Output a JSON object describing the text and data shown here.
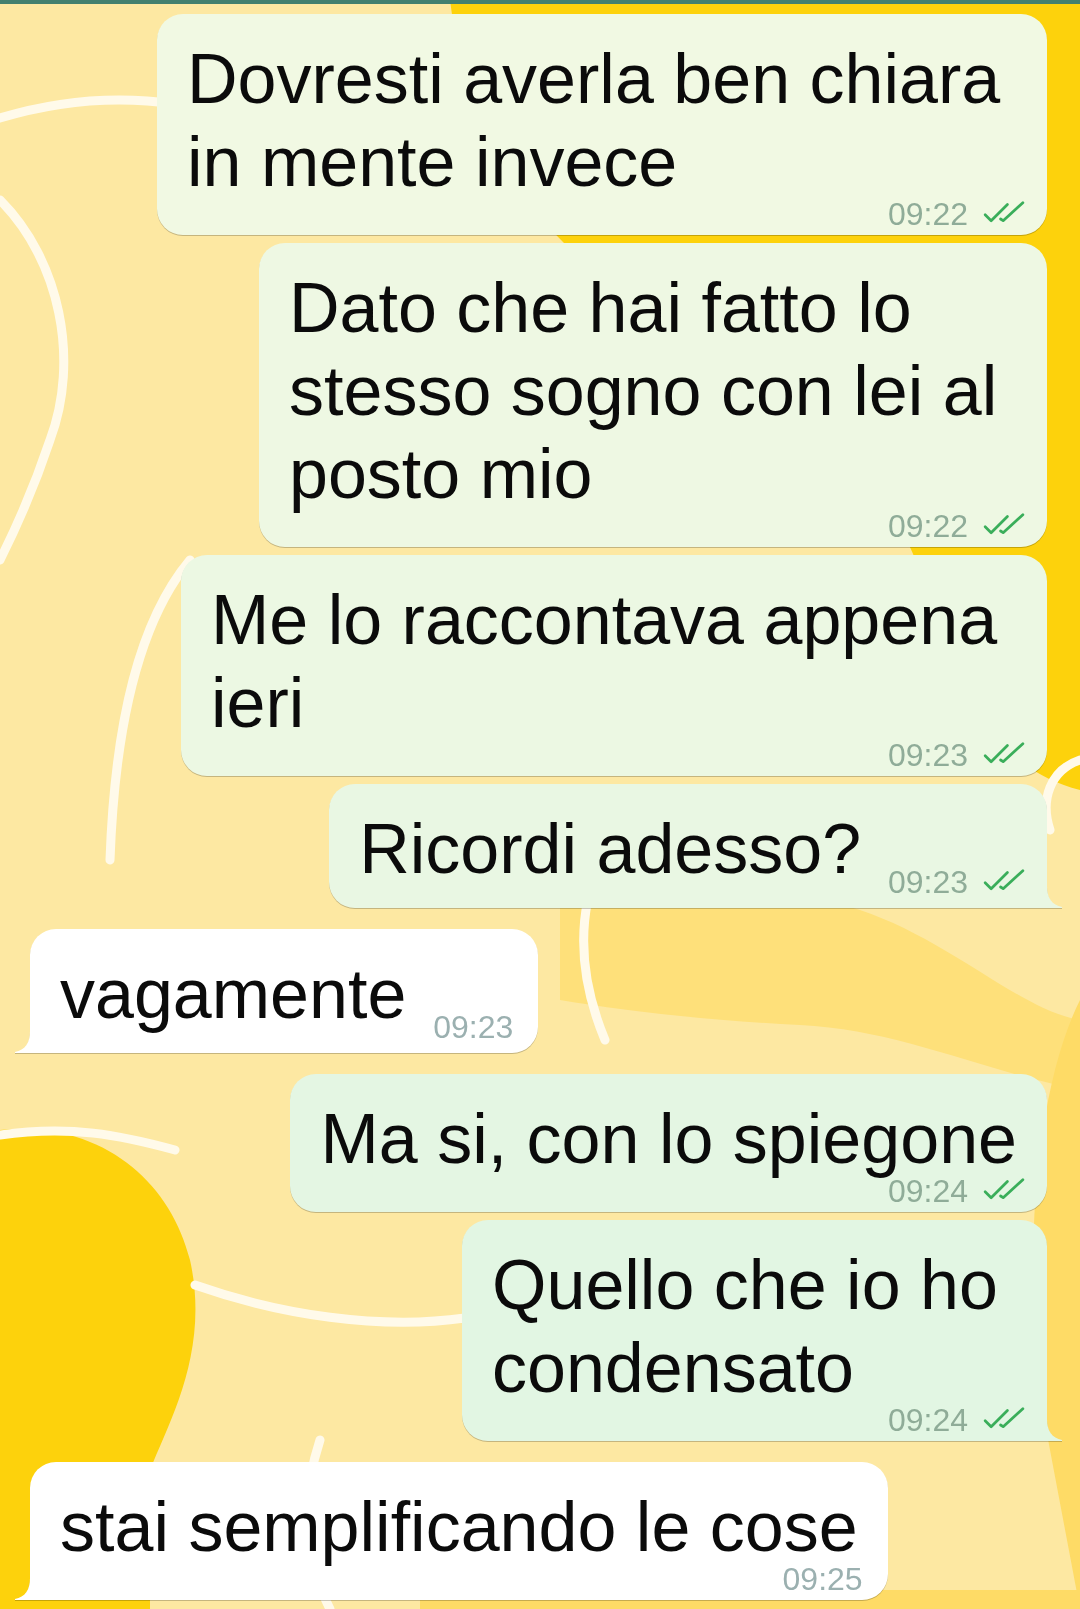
{
  "messages": [
    {
      "kind": "outgoing",
      "text": "Dovresti averla ben chiara in mente invece",
      "time": "09:22",
      "read": true
    },
    {
      "kind": "outgoing",
      "text": "Dato che hai fatto lo stesso sogno con lei al posto mio",
      "time": "09:22",
      "read": true
    },
    {
      "kind": "outgoing",
      "text": "Me lo raccontava appena ieri",
      "time": "09:23",
      "read": true
    },
    {
      "kind": "outgoing",
      "text": "Ricordi adesso?",
      "time": "09:23",
      "read": true
    },
    {
      "kind": "incoming",
      "text": "vagamente",
      "time": "09:23"
    },
    {
      "kind": "outgoing",
      "text": "Ma si, con lo spiegone",
      "time": "09:24",
      "read": true
    },
    {
      "kind": "outgoing",
      "text": "Quello che io ho condensato",
      "time": "09:24",
      "read": true
    },
    {
      "kind": "incoming",
      "text": "stai semplificando le cose",
      "time": "09:25"
    }
  ]
}
